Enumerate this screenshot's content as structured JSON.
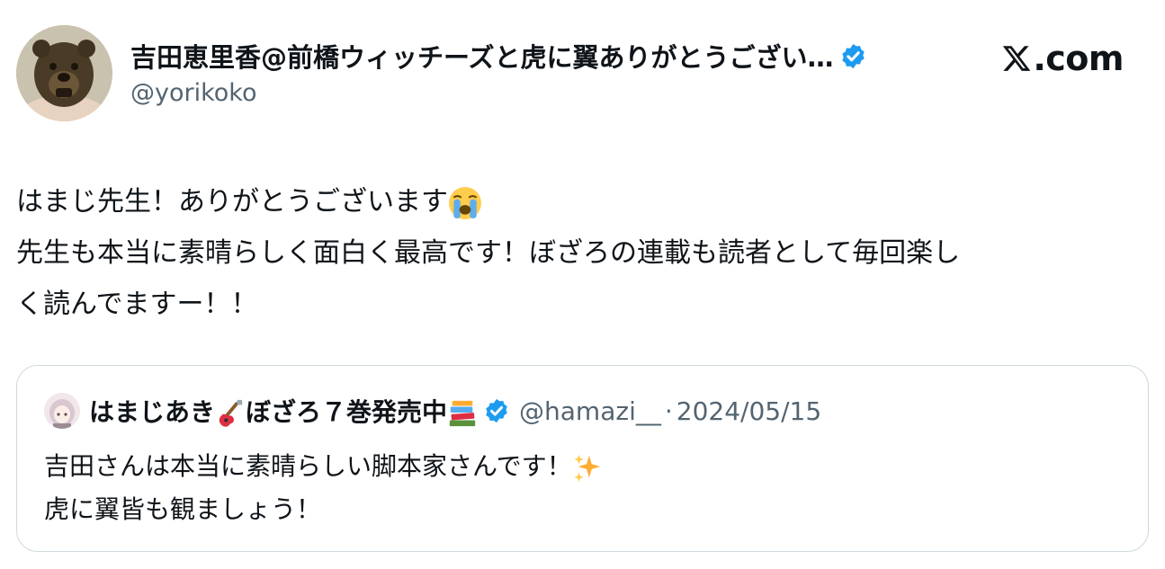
{
  "author": {
    "display_name": "吉田恵里香@前橋ウィッチーズと虎に翼ありがとうござい…",
    "handle": "@yorikoko",
    "verified": true,
    "avatar_icon": "carved-bear-mask-avatar"
  },
  "brand": {
    "label": ".com",
    "icon": "x-logo-icon"
  },
  "tweet": {
    "lines": [
      "はまじ先生！ありがとうございます",
      "先生も本当に素晴らしく面白く最高です！ぼざろの連載も読者として毎回楽し",
      "く読んでますー！！"
    ],
    "emoji": "loudly-crying-face-emoji"
  },
  "quote": {
    "display_name_part1": "はまじあき",
    "display_name_part2": "ぼざろ７巻発売中",
    "name_emojis": [
      "guitar-emoji",
      "books-emoji"
    ],
    "handle": "@hamazi__",
    "separator": "·",
    "date": "2024/05/15",
    "verified": true,
    "lines": [
      "吉田さんは本当に素晴らしい脚本家さんです！",
      "虎に翼皆も観ましょう！"
    ],
    "emoji": "sparkles-emoji"
  },
  "colors": {
    "text": "#0f1419",
    "secondary": "#536471",
    "verified_blue": "#1d9bf0",
    "border": "#cfd9de"
  }
}
